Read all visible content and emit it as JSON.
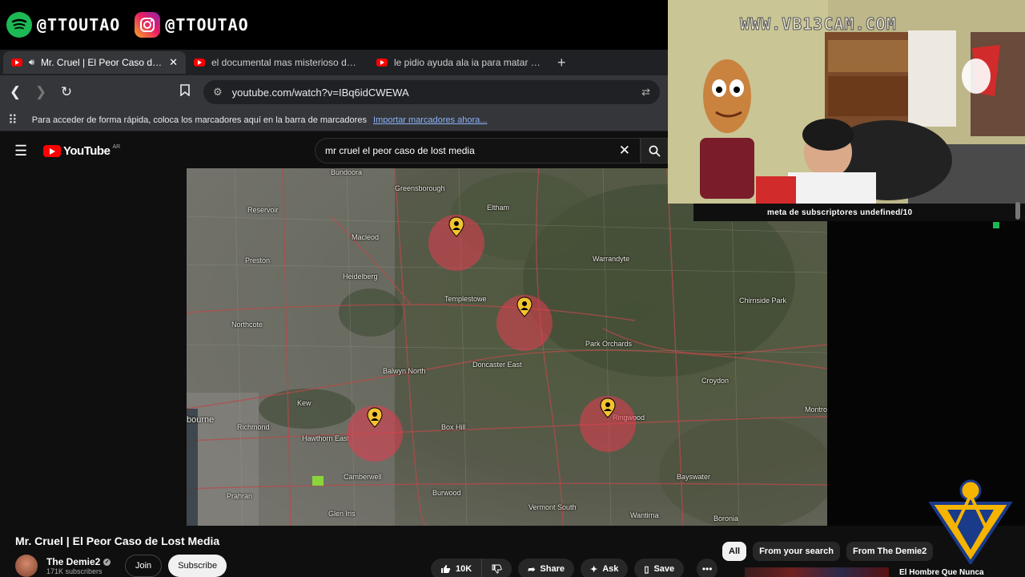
{
  "social": {
    "spotify_handle": "@TTOUTAO",
    "instagram_handle": "@TTOUTAO"
  },
  "browser": {
    "tabs": [
      {
        "label": "Mr. Cruel | El Peor Caso de Lo",
        "active": true
      },
      {
        "label": "el documental mas misterioso del m",
        "active": false
      },
      {
        "label": "le pidio ayuda ala ia para matar a su",
        "active": false
      }
    ],
    "close_glyph": "✕",
    "new_tab_glyph": "+",
    "url": "youtube.com/watch?v=IBq6idCWEWA",
    "bookmarks_text": "Para acceder de forma rápida, coloca los marcadores aquí en la barra de marcadores",
    "bookmarks_link": "Importar marcadores ahora..."
  },
  "youtube": {
    "logo_text": "YouTube",
    "country_code": "AR",
    "search_query": "mr cruel el peor caso de lost media",
    "video": {
      "title": "Mr. Cruel | El Peor Caso de Lost Media",
      "channel": "The Demie2",
      "subscribers": "171K subscribers",
      "join_label": "Join",
      "subscribe_label": "Subscribe",
      "likes": "10K",
      "share_label": "Share",
      "ask_label": "Ask",
      "save_label": "Save"
    },
    "chips": [
      "All",
      "From your search",
      "From The Demie2"
    ],
    "next_video_title": "El Hombre Que Nunca"
  },
  "map": {
    "labels": [
      "Bundoora",
      "Greensborough",
      "Eltham",
      "Reservoir",
      "Macleod",
      "Preston",
      "Warrandyte",
      "Heidelberg",
      "Templestowe",
      "Northcote",
      "Park Orchards",
      "Chirnside Park",
      "Doncaster East",
      "Balwyn North",
      "Croydon",
      "Kew",
      "Richmond",
      "Hawthorn East",
      "Box Hill",
      "Ringwood",
      "Montrose",
      "Camberwell",
      "Burwood",
      "Prahran",
      "Glen Iris",
      "Vermont South",
      "Bayswater",
      "Wantirna",
      "Boronia",
      "bourne"
    ]
  },
  "stream": {
    "watermark": "WWW.VB13CAM.COM",
    "subscriber_goal": "meta de subscriptores undefined/10"
  },
  "colors": {
    "yt_red": "#ff0000",
    "pin_overlay": "#e63c50",
    "pin_yellow": "#f4c430",
    "spotify_green": "#1db954"
  }
}
